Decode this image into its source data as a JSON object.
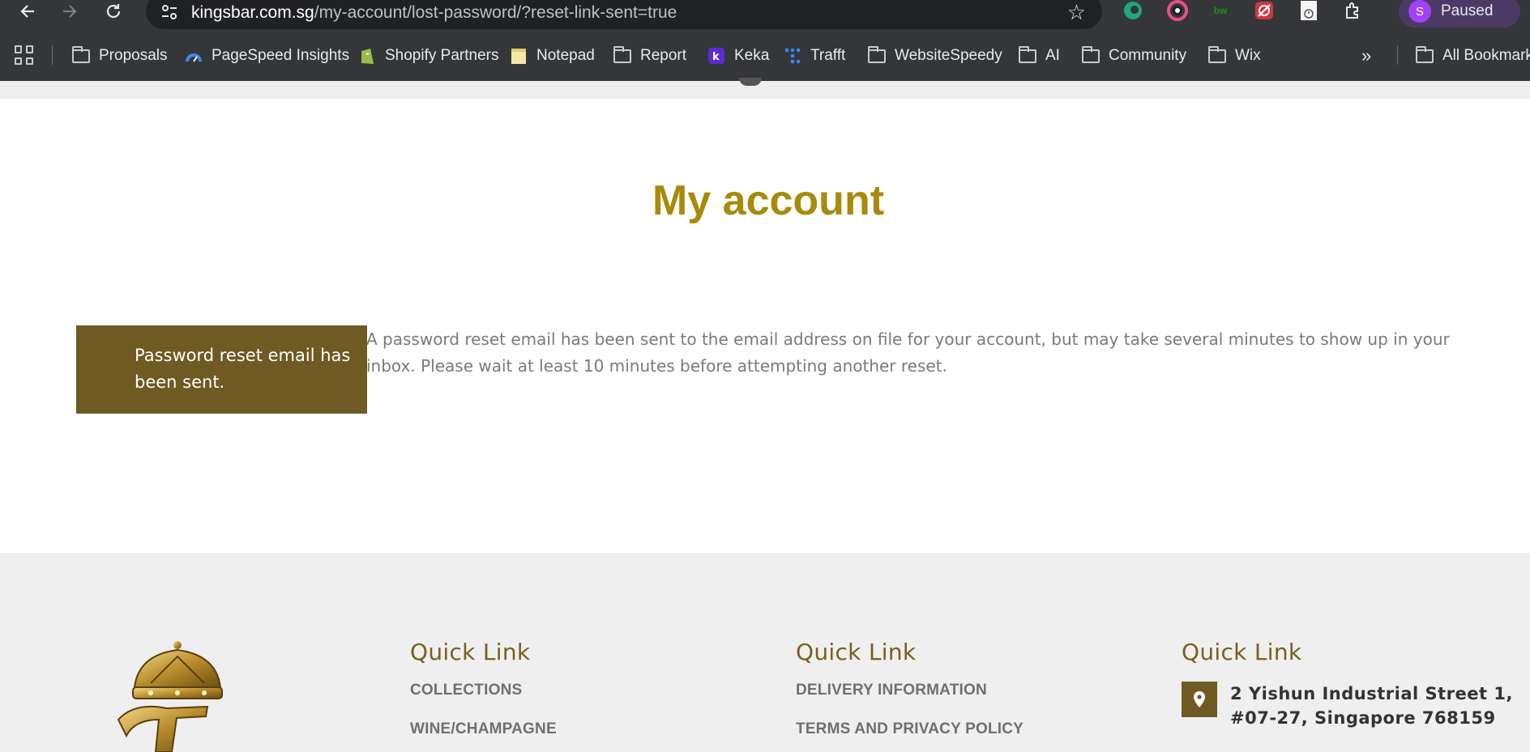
{
  "browser": {
    "url_host": "kingsbar.com.sg",
    "url_path": "/my-account/lost-password/?reset-link-sent=true",
    "profile_initial": "S",
    "profile_status": "Paused",
    "extensions": [
      "edge-icon",
      "color-picker-icon",
      "bw-icon",
      "debug-icon",
      "timer-icon",
      "puzzle-icon"
    ],
    "ext_bw_label": "bw"
  },
  "bookmarks": [
    {
      "label": "Proposals",
      "icon": "folder-icon"
    },
    {
      "label": "PageSpeed Insights",
      "icon": "pagespeed-icon"
    },
    {
      "label": "Shopify Partners",
      "icon": "shopify-icon"
    },
    {
      "label": "Notepad",
      "icon": "notepad-icon"
    },
    {
      "label": "Report",
      "icon": "folder-icon"
    },
    {
      "label": "Keka",
      "icon": "keka-icon"
    },
    {
      "label": "Trafft",
      "icon": "trafft-icon"
    },
    {
      "label": "WebsiteSpeedy",
      "icon": "folder-icon"
    },
    {
      "label": "AI",
      "icon": "folder-icon"
    },
    {
      "label": "Community",
      "icon": "folder-icon"
    },
    {
      "label": "Wix",
      "icon": "folder-icon"
    }
  ],
  "bookmarks_overflow": "»",
  "all_bookmarks": "All Bookmarks",
  "page": {
    "title": "My account",
    "notice": "Password reset email has been sent.",
    "notice_text": "A password reset email has been sent to the email address on file for your account, but may take several minutes to show up in your inbox. Please wait at least 10 minutes before attempting another reset."
  },
  "footer": {
    "col1": {
      "heading": "Quick Link",
      "links": [
        "COLLECTIONS",
        "WINE/CHAMPAGNE"
      ]
    },
    "col2": {
      "heading": "Quick Link",
      "links": [
        "DELIVERY INFORMATION",
        "TERMS AND PRIVACY POLICY"
      ]
    },
    "col3": {
      "heading": "Quick Link",
      "address_line1": "2 Yishun Industrial Street 1,",
      "address_line2": "#07-27, Singapore 768159"
    }
  },
  "colors": {
    "brand_gold": "#a88a0c",
    "brand_brown": "#6e5a22",
    "chrome_bg": "#35363a"
  }
}
